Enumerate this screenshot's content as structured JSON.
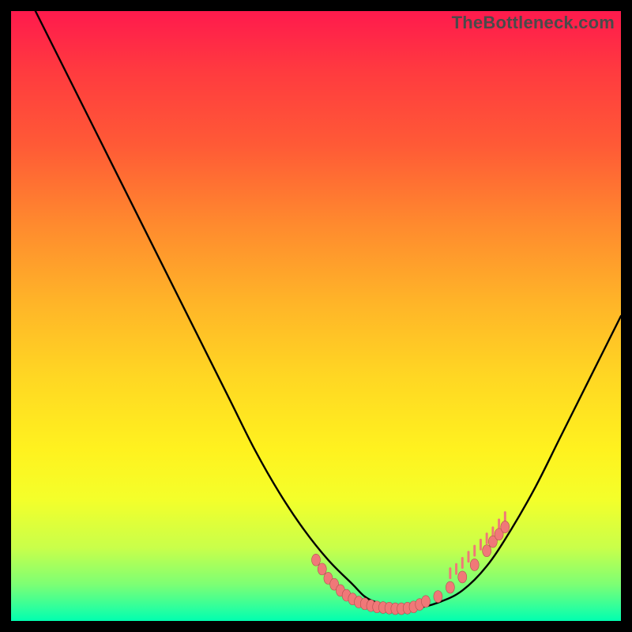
{
  "watermark": {
    "text": "TheBottleneck.com"
  },
  "colors": {
    "curve": "#000000",
    "dot_fill": "#f07878",
    "dot_stroke": "#b05050"
  },
  "chart_data": {
    "type": "line",
    "title": "",
    "xlabel": "",
    "ylabel": "",
    "xlim": [
      0,
      100
    ],
    "ylim": [
      0,
      100
    ],
    "grid": false,
    "legend": false,
    "series": [
      {
        "name": "bottleneck-curve",
        "x": [
          4,
          8,
          12,
          16,
          20,
          24,
          28,
          32,
          36,
          40,
          44,
          48,
          52,
          56,
          58,
          60,
          63,
          66,
          70,
          74,
          78,
          82,
          86,
          90,
          94,
          98,
          100
        ],
        "y": [
          100,
          92,
          84,
          76,
          68,
          60,
          52,
          44,
          36,
          28,
          21,
          15,
          10,
          6,
          4,
          3,
          2,
          2,
          3,
          5,
          9,
          15,
          22,
          30,
          38,
          46,
          50
        ]
      }
    ],
    "annotations": {
      "dot_cluster": {
        "comment": "salmon dots near curve minimum and rising right arm",
        "points": [
          {
            "x": 50,
            "y": 10
          },
          {
            "x": 51,
            "y": 8.5
          },
          {
            "x": 52,
            "y": 7
          },
          {
            "x": 53,
            "y": 6
          },
          {
            "x": 54,
            "y": 5
          },
          {
            "x": 55,
            "y": 4.2
          },
          {
            "x": 56,
            "y": 3.6
          },
          {
            "x": 57,
            "y": 3.1
          },
          {
            "x": 58,
            "y": 2.8
          },
          {
            "x": 59,
            "y": 2.5
          },
          {
            "x": 60,
            "y": 2.3
          },
          {
            "x": 61,
            "y": 2.2
          },
          {
            "x": 62,
            "y": 2.1
          },
          {
            "x": 63,
            "y": 2.0
          },
          {
            "x": 64,
            "y": 2.0
          },
          {
            "x": 65,
            "y": 2.1
          },
          {
            "x": 66,
            "y": 2.3
          },
          {
            "x": 67,
            "y": 2.7
          },
          {
            "x": 68,
            "y": 3.2
          },
          {
            "x": 70,
            "y": 4.0
          },
          {
            "x": 72,
            "y": 5.5
          },
          {
            "x": 74,
            "y": 7.2
          },
          {
            "x": 76,
            "y": 9.2
          },
          {
            "x": 78,
            "y": 11.5
          },
          {
            "x": 79,
            "y": 13
          },
          {
            "x": 80,
            "y": 14.2
          },
          {
            "x": 81,
            "y": 15.4
          }
        ]
      },
      "tick_marks": {
        "comment": "short vertical salmon ticks above dot cluster on right side",
        "points": [
          {
            "x": 72,
            "y": 7.3
          },
          {
            "x": 73,
            "y": 8.0
          },
          {
            "x": 74,
            "y": 9.0
          },
          {
            "x": 75,
            "y": 10.0
          },
          {
            "x": 76,
            "y": 11.0
          },
          {
            "x": 77,
            "y": 12.0
          },
          {
            "x": 78,
            "y": 13.0
          },
          {
            "x": 79,
            "y": 14.0
          },
          {
            "x": 80,
            "y": 15.3
          },
          {
            "x": 81,
            "y": 16.5
          }
        ]
      }
    }
  }
}
